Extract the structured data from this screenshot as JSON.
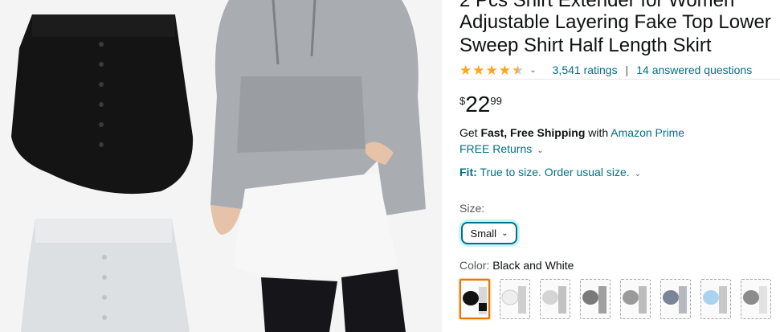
{
  "product": {
    "title_lines": [
      "2 Pcs Shirt Extender for Women",
      "Adjustable Layering Fake Top Lower",
      "Sweep Shirt Half Length Skirt"
    ],
    "rating": 4.3,
    "ratings_text": "3,541 ratings",
    "separator": "|",
    "questions_text": "14 answered questions",
    "price": {
      "symbol": "$",
      "whole": "22",
      "fraction": "99"
    },
    "shipping": {
      "get": "Get ",
      "bold": "Fast, Free Shipping",
      "with": " with ",
      "link": "Amazon Prime"
    },
    "returns": "FREE Returns",
    "fit": {
      "label": "Fit:",
      "value": "True to size. Order usual size."
    },
    "size": {
      "label": "Size:",
      "selected": "Small"
    },
    "color": {
      "label": "Color: ",
      "value": "Black and White"
    }
  },
  "colors": {
    "accent": "#007185",
    "star": "#ffa41c",
    "selected_swatch": "#e77600",
    "swatches": [
      "black",
      "white",
      "light-gray",
      "dark-gray",
      "gray",
      "blue-gray",
      "light-blue",
      "gray-white"
    ]
  }
}
